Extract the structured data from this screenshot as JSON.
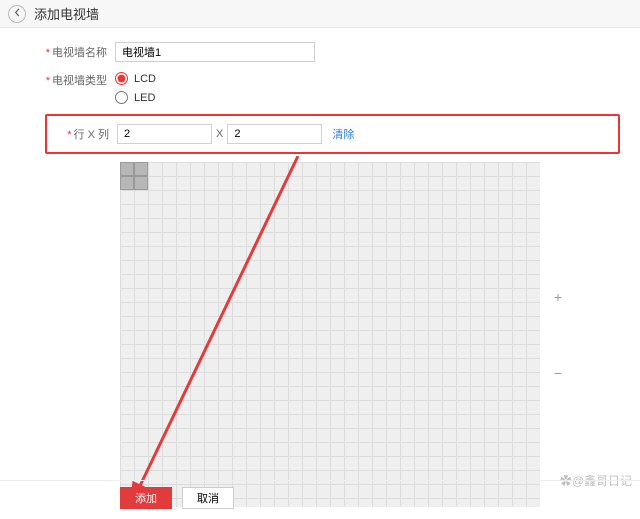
{
  "header": {
    "title": "添加电视墙"
  },
  "form": {
    "name_label": "电视墙名称",
    "name_value": "电视墙1",
    "type_label": "电视墙类型",
    "type_options": {
      "lcd": "LCD",
      "led": "LED"
    },
    "rowcol_label": "行 X 列",
    "rows_value": "2",
    "cols_value": "2",
    "x_separator": "X",
    "clear_label": "清除"
  },
  "zoom": {
    "plus": "+",
    "minus": "−"
  },
  "footer": {
    "add": "添加",
    "cancel": "取消"
  },
  "icons": {
    "back": "back-arrow-icon"
  },
  "watermark": "✿@鑫哥日记"
}
